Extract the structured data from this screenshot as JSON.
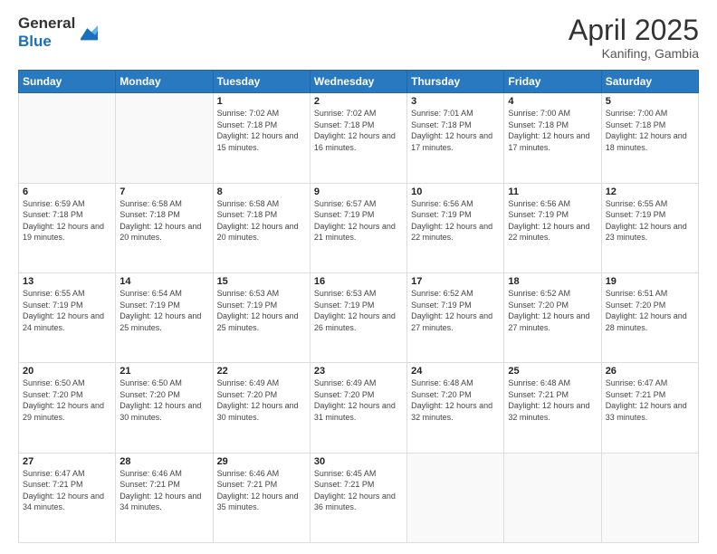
{
  "logo": {
    "general": "General",
    "blue": "Blue"
  },
  "title": {
    "month": "April 2025",
    "location": "Kanifing, Gambia"
  },
  "header_days": [
    "Sunday",
    "Monday",
    "Tuesday",
    "Wednesday",
    "Thursday",
    "Friday",
    "Saturday"
  ],
  "weeks": [
    [
      {
        "day": "",
        "info": ""
      },
      {
        "day": "",
        "info": ""
      },
      {
        "day": "1",
        "info": "Sunrise: 7:02 AM\nSunset: 7:18 PM\nDaylight: 12 hours and 15 minutes."
      },
      {
        "day": "2",
        "info": "Sunrise: 7:02 AM\nSunset: 7:18 PM\nDaylight: 12 hours and 16 minutes."
      },
      {
        "day": "3",
        "info": "Sunrise: 7:01 AM\nSunset: 7:18 PM\nDaylight: 12 hours and 17 minutes."
      },
      {
        "day": "4",
        "info": "Sunrise: 7:00 AM\nSunset: 7:18 PM\nDaylight: 12 hours and 17 minutes."
      },
      {
        "day": "5",
        "info": "Sunrise: 7:00 AM\nSunset: 7:18 PM\nDaylight: 12 hours and 18 minutes."
      }
    ],
    [
      {
        "day": "6",
        "info": "Sunrise: 6:59 AM\nSunset: 7:18 PM\nDaylight: 12 hours and 19 minutes."
      },
      {
        "day": "7",
        "info": "Sunrise: 6:58 AM\nSunset: 7:18 PM\nDaylight: 12 hours and 20 minutes."
      },
      {
        "day": "8",
        "info": "Sunrise: 6:58 AM\nSunset: 7:18 PM\nDaylight: 12 hours and 20 minutes."
      },
      {
        "day": "9",
        "info": "Sunrise: 6:57 AM\nSunset: 7:19 PM\nDaylight: 12 hours and 21 minutes."
      },
      {
        "day": "10",
        "info": "Sunrise: 6:56 AM\nSunset: 7:19 PM\nDaylight: 12 hours and 22 minutes."
      },
      {
        "day": "11",
        "info": "Sunrise: 6:56 AM\nSunset: 7:19 PM\nDaylight: 12 hours and 22 minutes."
      },
      {
        "day": "12",
        "info": "Sunrise: 6:55 AM\nSunset: 7:19 PM\nDaylight: 12 hours and 23 minutes."
      }
    ],
    [
      {
        "day": "13",
        "info": "Sunrise: 6:55 AM\nSunset: 7:19 PM\nDaylight: 12 hours and 24 minutes."
      },
      {
        "day": "14",
        "info": "Sunrise: 6:54 AM\nSunset: 7:19 PM\nDaylight: 12 hours and 25 minutes."
      },
      {
        "day": "15",
        "info": "Sunrise: 6:53 AM\nSunset: 7:19 PM\nDaylight: 12 hours and 25 minutes."
      },
      {
        "day": "16",
        "info": "Sunrise: 6:53 AM\nSunset: 7:19 PM\nDaylight: 12 hours and 26 minutes."
      },
      {
        "day": "17",
        "info": "Sunrise: 6:52 AM\nSunset: 7:19 PM\nDaylight: 12 hours and 27 minutes."
      },
      {
        "day": "18",
        "info": "Sunrise: 6:52 AM\nSunset: 7:20 PM\nDaylight: 12 hours and 27 minutes."
      },
      {
        "day": "19",
        "info": "Sunrise: 6:51 AM\nSunset: 7:20 PM\nDaylight: 12 hours and 28 minutes."
      }
    ],
    [
      {
        "day": "20",
        "info": "Sunrise: 6:50 AM\nSunset: 7:20 PM\nDaylight: 12 hours and 29 minutes."
      },
      {
        "day": "21",
        "info": "Sunrise: 6:50 AM\nSunset: 7:20 PM\nDaylight: 12 hours and 30 minutes."
      },
      {
        "day": "22",
        "info": "Sunrise: 6:49 AM\nSunset: 7:20 PM\nDaylight: 12 hours and 30 minutes."
      },
      {
        "day": "23",
        "info": "Sunrise: 6:49 AM\nSunset: 7:20 PM\nDaylight: 12 hours and 31 minutes."
      },
      {
        "day": "24",
        "info": "Sunrise: 6:48 AM\nSunset: 7:20 PM\nDaylight: 12 hours and 32 minutes."
      },
      {
        "day": "25",
        "info": "Sunrise: 6:48 AM\nSunset: 7:21 PM\nDaylight: 12 hours and 32 minutes."
      },
      {
        "day": "26",
        "info": "Sunrise: 6:47 AM\nSunset: 7:21 PM\nDaylight: 12 hours and 33 minutes."
      }
    ],
    [
      {
        "day": "27",
        "info": "Sunrise: 6:47 AM\nSunset: 7:21 PM\nDaylight: 12 hours and 34 minutes."
      },
      {
        "day": "28",
        "info": "Sunrise: 6:46 AM\nSunset: 7:21 PM\nDaylight: 12 hours and 34 minutes."
      },
      {
        "day": "29",
        "info": "Sunrise: 6:46 AM\nSunset: 7:21 PM\nDaylight: 12 hours and 35 minutes."
      },
      {
        "day": "30",
        "info": "Sunrise: 6:45 AM\nSunset: 7:21 PM\nDaylight: 12 hours and 36 minutes."
      },
      {
        "day": "",
        "info": ""
      },
      {
        "day": "",
        "info": ""
      },
      {
        "day": "",
        "info": ""
      }
    ]
  ]
}
